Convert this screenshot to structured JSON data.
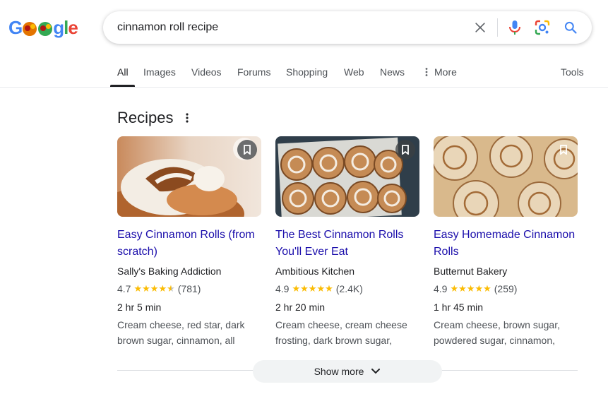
{
  "logo": {
    "text_start": "G",
    "text_end": "gle",
    "letters": [
      "G",
      "o",
      "o",
      "g",
      "l",
      "e"
    ]
  },
  "search": {
    "query": "cinnamon roll recipe"
  },
  "tabs": [
    {
      "label": "All",
      "active": true
    },
    {
      "label": "Images"
    },
    {
      "label": "Videos"
    },
    {
      "label": "Forums"
    },
    {
      "label": "Shopping"
    },
    {
      "label": "Web"
    },
    {
      "label": "News"
    },
    {
      "label": "More"
    },
    {
      "label": "Tools"
    }
  ],
  "recipes": {
    "title": "Recipes",
    "cards": [
      {
        "title": "Easy Cinnamon Rolls (from scratch)",
        "source": "Sally's Baking Addiction",
        "rating": "4.7",
        "stars": 4.5,
        "reviews": "(781)",
        "time": "2 hr 5 min",
        "ingredients": "Cream cheese, red star, dark brown sugar, cinnamon, all"
      },
      {
        "title": "The Best Cinnamon Rolls You'll Ever Eat",
        "source": "Ambitious Kitchen",
        "rating": "4.9",
        "stars": 5,
        "reviews": "(2.4K)",
        "time": "2 hr 20 min",
        "ingredients": "Cream cheese, cream cheese frosting, dark brown sugar,"
      },
      {
        "title": "Easy Homemade Cinnamon Rolls",
        "source": "Butternut Bakery",
        "rating": "4.9",
        "stars": 5,
        "reviews": "(259)",
        "time": "1 hr 45 min",
        "ingredients": "Cream cheese, brown sugar, powdered sugar, cinnamon,"
      }
    ],
    "show_more": "Show more"
  },
  "colors": {
    "link": "#1a0dab",
    "star": "#fbbc04",
    "google_blue": "#4285f4",
    "google_red": "#ea4335",
    "google_yellow": "#fbbc05",
    "google_green": "#34a853"
  },
  "icons": [
    "clear-icon",
    "microphone-icon",
    "lens-icon",
    "search-icon",
    "more-vert-icon",
    "bookmark-icon",
    "chevron-down-icon"
  ]
}
